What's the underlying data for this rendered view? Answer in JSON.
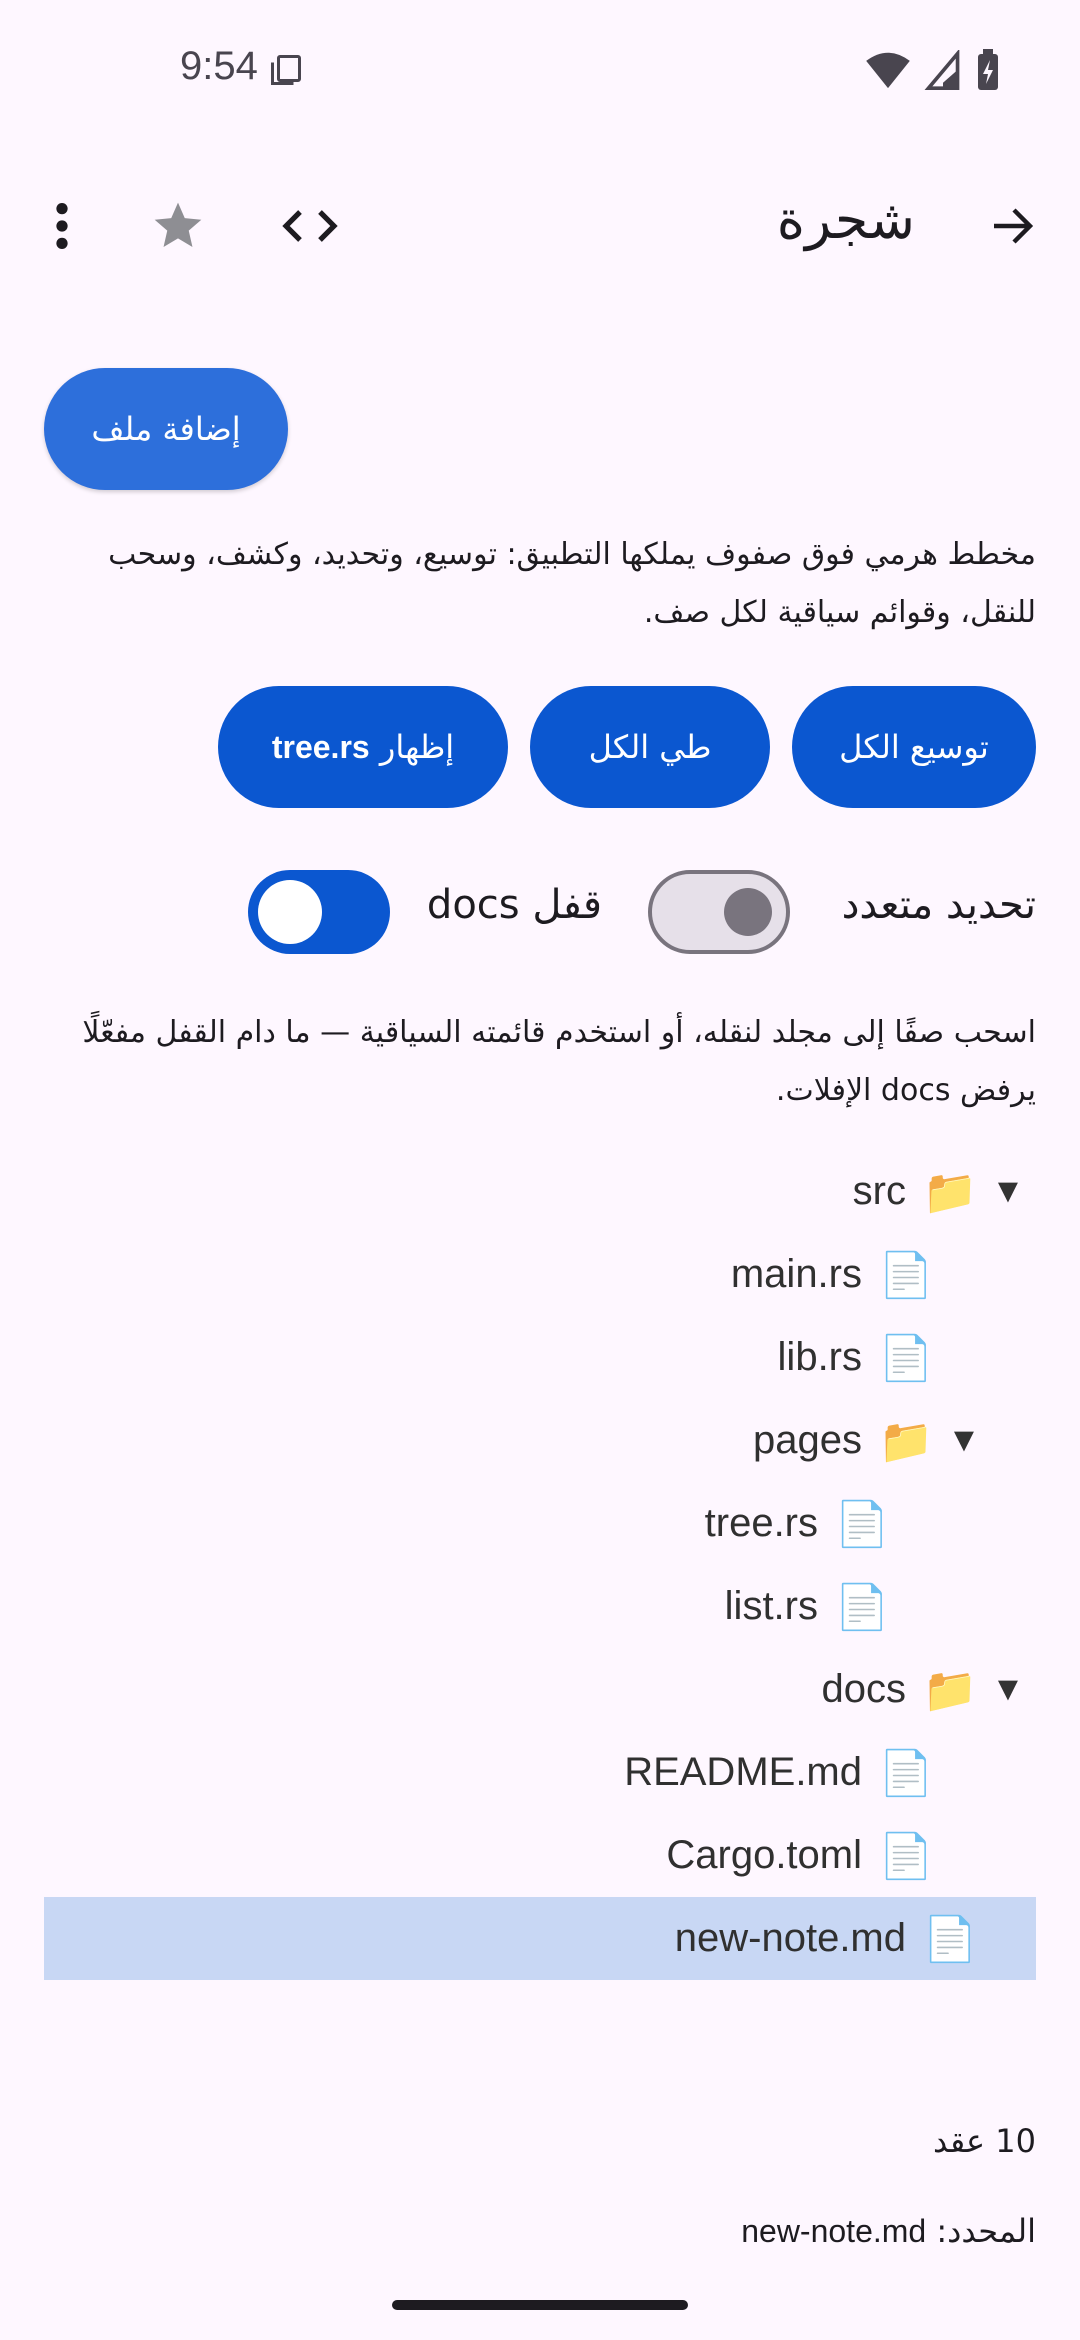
{
  "status_bar": {
    "time": "9:54"
  },
  "app_bar": {
    "title": "شجرة"
  },
  "actions": {
    "add_file": "إضافة ملف",
    "expand_all": "توسيع الكل",
    "collapse_all": "طي الكل",
    "show_prefix": "إظهار ",
    "show_file": "tree.rs"
  },
  "description": "مخطط هرمي فوق صفوف يملكها التطبيق: توسيع، وتحديد، وكشف، وسحب للنقل، وقوائم سياقية لكل صف.",
  "toggles": {
    "multi_select": {
      "label": "تحديد متعدد",
      "on": false
    },
    "lock_docs": {
      "label": "قفل docs",
      "on": true
    }
  },
  "hint": "اسحب صفًا إلى مجلد لنقله، أو استخدم قائمته السياقية — ما دام القفل مفعّلًا يرفض docs الإفلات.",
  "tree": [
    {
      "name": "src",
      "type": "folder",
      "depth": 0,
      "expanded": true
    },
    {
      "name": "main.rs",
      "type": "file",
      "depth": 1
    },
    {
      "name": "lib.rs",
      "type": "file",
      "depth": 1
    },
    {
      "name": "pages",
      "type": "folder",
      "depth": 1,
      "expanded": true
    },
    {
      "name": "tree.rs",
      "type": "file",
      "depth": 2
    },
    {
      "name": "list.rs",
      "type": "file",
      "depth": 2
    },
    {
      "name": "docs",
      "type": "folder",
      "depth": 0,
      "expanded": true
    },
    {
      "name": "README.md",
      "type": "file",
      "depth": 1
    },
    {
      "name": "Cargo.toml",
      "type": "file",
      "depth": 1
    },
    {
      "name": "new-note.md",
      "type": "file",
      "depth": 0,
      "selected": true
    }
  ],
  "footer": {
    "count": "10 عقد",
    "selected_label": "المحدد: ",
    "selected_value": "new-note.md"
  },
  "icons": {
    "arrow": "▼",
    "folder": "📁",
    "file": "📄"
  },
  "colors": {
    "primary": "#0B57D0",
    "selected_row": "#C8D7F4",
    "background": "#FEF7FF"
  }
}
